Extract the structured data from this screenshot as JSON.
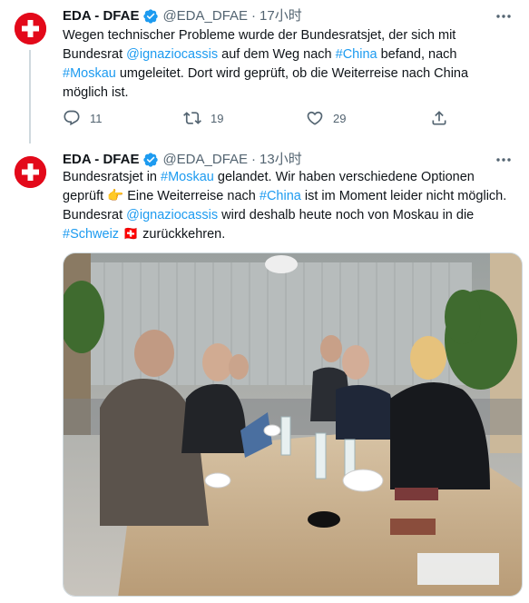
{
  "tweets": [
    {
      "name": "EDA - DFAE",
      "handle": "@EDA_DFAE",
      "separator": "·",
      "time": "17小时",
      "text": [
        {
          "t": "Wegen technischer Probleme wurde der Bundesratsjet, der sich mit Bundesrat ",
          "link": false
        },
        {
          "t": "@ignaziocassis",
          "link": true
        },
        {
          "t": " auf dem Weg nach ",
          "link": false
        },
        {
          "t": "#China",
          "link": true
        },
        {
          "t": " befand, nach ",
          "link": false
        },
        {
          "t": "#Moskau",
          "link": true
        },
        {
          "t": " umgeleitet. Dort wird geprüft, ob die Weiterreise nach China möglich ist.",
          "link": false
        }
      ],
      "replies": "11",
      "retweets": "19",
      "likes": "29"
    },
    {
      "name": "EDA - DFAE",
      "handle": "@EDA_DFAE",
      "separator": "·",
      "time": "13小时",
      "text": [
        {
          "t": "Bundesratsjet in ",
          "link": false
        },
        {
          "t": "#Moskau",
          "link": true
        },
        {
          "t": " gelandet. Wir haben verschiedene Optionen geprüft 👉 Eine Weiterreise nach ",
          "link": false
        },
        {
          "t": "#China",
          "link": true
        },
        {
          "t": " ist im Moment leider nicht möglich. Bundesrat ",
          "link": false
        },
        {
          "t": "@ignaziocassis",
          "link": true
        },
        {
          "t": " wird deshalb heute noch von Moskau in die ",
          "link": false
        },
        {
          "t": "#Schweiz",
          "link": true
        },
        {
          "t": " 🇨🇭 zurückkehren.",
          "link": false
        }
      ]
    }
  ],
  "icons": {
    "avatar": "swiss-flag-icon",
    "verified": "verified-badge-icon",
    "more": "more-options-icon",
    "reply": "reply-icon",
    "retweet": "retweet-icon",
    "like": "like-icon",
    "share": "share-icon"
  },
  "colors": {
    "accent": "#1d9bf0",
    "text": "#0f1419",
    "muted": "#536471",
    "swiss_red": "#e3091a"
  }
}
